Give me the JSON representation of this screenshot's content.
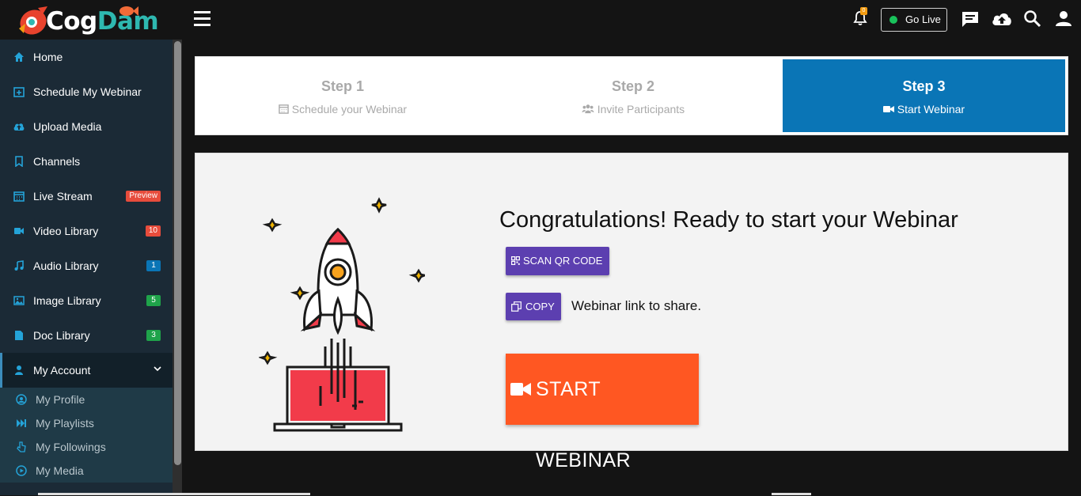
{
  "app": {
    "logo_part1": "Cog",
    "logo_part2": "Dam"
  },
  "header": {
    "menu_icon": "hamburger-icon",
    "notification_count": "0",
    "go_live_label": "Go Live",
    "icons": [
      "bell-icon",
      "chat-icon",
      "upload-cloud-icon",
      "search-icon",
      "user-icon"
    ]
  },
  "sidebar": {
    "items": [
      {
        "label": "Home",
        "icon": "home-icon"
      },
      {
        "label": "Schedule My Webinar",
        "icon": "calendar-plus-icon"
      },
      {
        "label": "Upload Media",
        "icon": "cloud-upload-icon"
      },
      {
        "label": "Channels",
        "icon": "bookmark-icon"
      },
      {
        "label": "Live Stream",
        "icon": "calendar-icon",
        "badge": "Preview",
        "badge_color": "#e74c3c"
      },
      {
        "label": "Video Library",
        "icon": "video-icon",
        "badge": "10",
        "badge_color": "#e74c3c"
      },
      {
        "label": "Audio Library",
        "icon": "music-icon",
        "badge": "1",
        "badge_color": "#0a75b6"
      },
      {
        "label": "Image Library",
        "icon": "image-icon",
        "badge": "5",
        "badge_color": "#1fa34a"
      },
      {
        "label": "Doc Library",
        "icon": "document-icon",
        "badge": "3",
        "badge_color": "#1fa34a"
      },
      {
        "label": "My Account",
        "icon": "user-icon",
        "expanded": true
      }
    ],
    "submenu": [
      {
        "label": "My Profile",
        "icon": "user-circle-icon"
      },
      {
        "label": "My Playlists",
        "icon": "fast-forward-icon"
      },
      {
        "label": "My Followings",
        "icon": "hand-pointer-icon"
      },
      {
        "label": "My Media",
        "icon": "play-circle-icon"
      }
    ]
  },
  "steps": [
    {
      "title": "Step 1",
      "subtitle": "Schedule your Webinar",
      "icon": "calendar-icon",
      "active": false
    },
    {
      "title": "Step 2",
      "subtitle": "Invite Participants",
      "icon": "users-icon",
      "active": false
    },
    {
      "title": "Step 3",
      "subtitle": "Start Webinar",
      "icon": "video-camera-icon",
      "active": true
    }
  ],
  "main": {
    "heading": "Congratulations! Ready to start your Webinar",
    "scan_qr_label": "SCAN QR CODE",
    "copy_label": "COPY",
    "share_label": "Webinar link to share.",
    "start_label": "START WEBINAR",
    "illustration": "rocket-launch-laptop-illustration"
  },
  "colors": {
    "accent_blue": "#0a75b6",
    "purple_button": "#5c3fb0",
    "start_orange": "#ff5722",
    "sidebar_bg": "#1b2a36"
  }
}
